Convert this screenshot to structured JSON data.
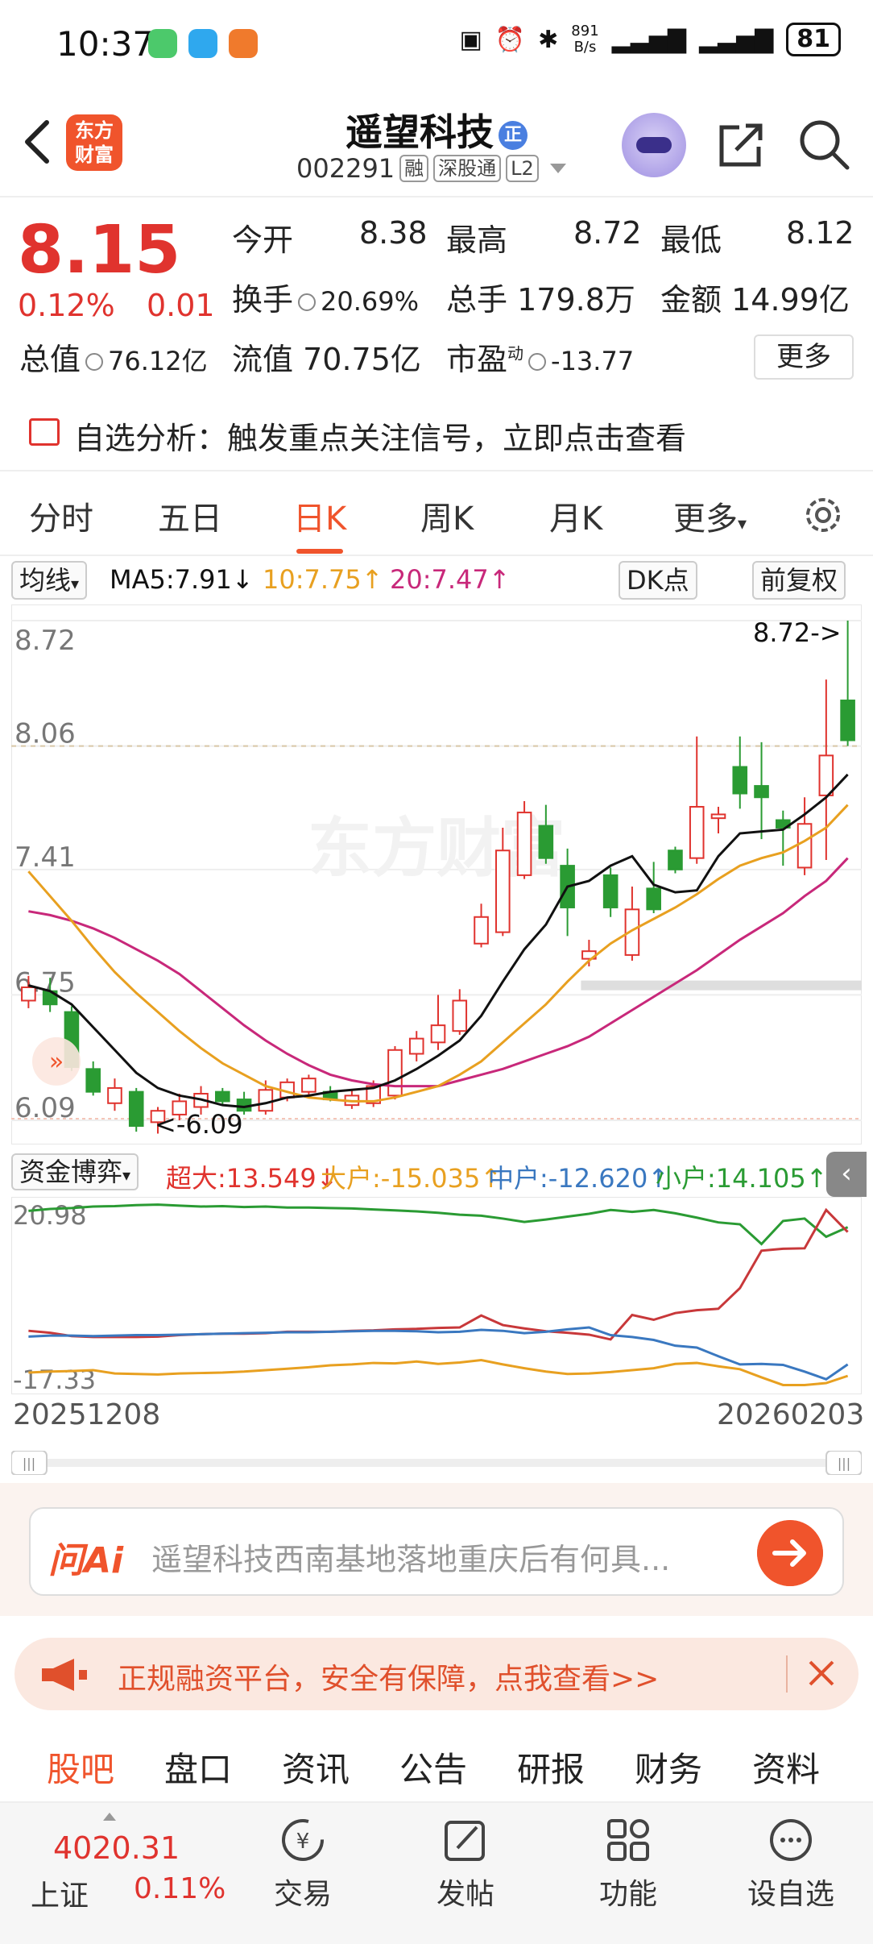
{
  "status_bar": {
    "time": "10:37",
    "net_speed_value": "891",
    "net_speed_unit": "B/s",
    "battery": "81"
  },
  "header": {
    "logo_text_1": "东方",
    "logo_text_2": "财富",
    "stock_name": "遥望科技",
    "badge": "正",
    "code": "002291",
    "tags": [
      "融",
      "深股通",
      "L2"
    ]
  },
  "quote": {
    "price": "8.15",
    "pct": "0.12%",
    "change": "0.01",
    "open_label": "今开",
    "open": "8.38",
    "high_label": "最高",
    "high": "8.72",
    "low_label": "最低",
    "low": "8.12",
    "turnover_label": "换手",
    "turnover": "20.69%",
    "volume_label": "总手",
    "volume": "179.8万",
    "amount_label": "金额",
    "amount": "14.99亿",
    "mktcap_label": "总值",
    "mktcap": "76.12亿",
    "float_label": "流值",
    "float": "70.75亿",
    "pe_label": "市盈",
    "pe_sup": "动",
    "pe": "-13.77",
    "more": "更多"
  },
  "notice": {
    "text": "自选分析：触发重点关注信号，立即点击查看"
  },
  "chart_tabs": [
    "分时",
    "五日",
    "日K",
    "周K",
    "月K",
    "更多"
  ],
  "active_chart_tab": "日K",
  "ma_row": {
    "selector": "均线",
    "ma5": "MA5:7.91↓",
    "ma10": "10:7.75↑",
    "ma20": "20:7.47↑",
    "dk": "DK点",
    "adjust": "前复权"
  },
  "colors": {
    "red": "#e0332e",
    "green": "#2a9b33",
    "ma5": "#111111",
    "ma10": "#e8a020",
    "ma20": "#c8287a",
    "accent": "#f0542c"
  },
  "chart_data": {
    "type": "candlestick",
    "y_labels": [
      "8.72",
      "8.06",
      "7.41",
      "6.75",
      "6.09"
    ],
    "ylim": [
      6.09,
      8.72
    ],
    "max_annotation": "8.72->",
    "min_annotation": "<-6.09",
    "watermark": "东方财富",
    "candles": [
      {
        "o": 6.72,
        "c": 6.79,
        "h": 6.85,
        "l": 6.68
      },
      {
        "o": 6.77,
        "c": 6.7,
        "h": 6.84,
        "l": 6.66
      },
      {
        "o": 6.66,
        "c": 6.37,
        "h": 6.69,
        "l": 6.35
      },
      {
        "o": 6.36,
        "c": 6.24,
        "h": 6.4,
        "l": 6.22
      },
      {
        "o": 6.18,
        "c": 6.26,
        "h": 6.31,
        "l": 6.14
      },
      {
        "o": 6.24,
        "c": 6.06,
        "h": 6.26,
        "l": 6.03
      },
      {
        "o": 6.08,
        "c": 6.14,
        "h": 6.16,
        "l": 6.02
      },
      {
        "o": 6.12,
        "c": 6.19,
        "h": 6.23,
        "l": 6.09
      },
      {
        "o": 6.16,
        "c": 6.23,
        "h": 6.27,
        "l": 6.12
      },
      {
        "o": 6.24,
        "c": 6.19,
        "h": 6.26,
        "l": 6.17
      },
      {
        "o": 6.2,
        "c": 6.14,
        "h": 6.24,
        "l": 6.12
      },
      {
        "o": 6.14,
        "c": 6.25,
        "h": 6.3,
        "l": 6.12
      },
      {
        "o": 6.21,
        "c": 6.29,
        "h": 6.31,
        "l": 6.19
      },
      {
        "o": 6.24,
        "c": 6.31,
        "h": 6.33,
        "l": 6.21
      },
      {
        "o": 6.24,
        "c": 6.2,
        "h": 6.27,
        "l": 6.19
      },
      {
        "o": 6.17,
        "c": 6.22,
        "h": 6.25,
        "l": 6.15
      },
      {
        "o": 6.18,
        "c": 6.27,
        "h": 6.3,
        "l": 6.16
      },
      {
        "o": 6.22,
        "c": 6.46,
        "h": 6.48,
        "l": 6.2
      },
      {
        "o": 6.44,
        "c": 6.52,
        "h": 6.56,
        "l": 6.4
      },
      {
        "o": 6.5,
        "c": 6.59,
        "h": 6.75,
        "l": 6.46
      },
      {
        "o": 6.56,
        "c": 6.72,
        "h": 6.78,
        "l": 6.54
      },
      {
        "o": 7.02,
        "c": 7.16,
        "h": 7.23,
        "l": 7.0
      },
      {
        "o": 7.08,
        "c": 7.51,
        "h": 7.63,
        "l": 7.06
      },
      {
        "o": 7.38,
        "c": 7.71,
        "h": 7.77,
        "l": 7.36
      },
      {
        "o": 7.64,
        "c": 7.47,
        "h": 7.75,
        "l": 7.44
      },
      {
        "o": 7.43,
        "c": 7.21,
        "h": 7.52,
        "l": 7.06
      },
      {
        "o": 6.94,
        "c": 6.98,
        "h": 7.04,
        "l": 6.9
      },
      {
        "o": 7.38,
        "c": 7.21,
        "h": 7.42,
        "l": 7.16
      },
      {
        "o": 6.96,
        "c": 7.2,
        "h": 7.32,
        "l": 6.93
      },
      {
        "o": 7.31,
        "c": 7.2,
        "h": 7.45,
        "l": 7.18
      },
      {
        "o": 7.51,
        "c": 7.41,
        "h": 7.53,
        "l": 7.39
      },
      {
        "o": 7.47,
        "c": 7.74,
        "h": 8.11,
        "l": 7.44
      },
      {
        "o": 7.68,
        "c": 7.7,
        "h": 7.74,
        "l": 7.6
      },
      {
        "o": 7.95,
        "c": 7.81,
        "h": 8.11,
        "l": 7.73
      },
      {
        "o": 7.85,
        "c": 7.79,
        "h": 8.08,
        "l": 7.57
      },
      {
        "o": 7.67,
        "c": 7.63,
        "h": 7.72,
        "l": 7.43
      },
      {
        "o": 7.42,
        "c": 7.65,
        "h": 7.79,
        "l": 7.38
      },
      {
        "o": 7.8,
        "c": 8.01,
        "h": 8.41,
        "l": 7.46
      },
      {
        "o": 8.3,
        "c": 8.09,
        "h": 8.72,
        "l": 8.06
      }
    ],
    "ma5": [
      6.8,
      6.77,
      6.7,
      6.58,
      6.46,
      6.34,
      6.26,
      6.22,
      6.2,
      6.17,
      6.16,
      6.18,
      6.21,
      6.22,
      6.24,
      6.25,
      6.26,
      6.3,
      6.36,
      6.43,
      6.51,
      6.64,
      6.82,
      6.99,
      7.12,
      7.32,
      7.35,
      7.43,
      7.48,
      7.33,
      7.29,
      7.3,
      7.48,
      7.6,
      7.61,
      7.62,
      7.7,
      7.79,
      7.91
    ],
    "ma10": [
      7.4,
      7.27,
      7.14,
      7.0,
      6.87,
      6.76,
      6.66,
      6.56,
      6.47,
      6.39,
      6.33,
      6.27,
      6.24,
      6.21,
      6.2,
      6.19,
      6.19,
      6.21,
      6.24,
      6.27,
      6.33,
      6.4,
      6.5,
      6.6,
      6.7,
      6.82,
      6.93,
      7.02,
      7.09,
      7.15,
      7.21,
      7.28,
      7.36,
      7.43,
      7.47,
      7.5,
      7.56,
      7.63,
      7.75
    ],
    "ma20": [
      7.19,
      7.17,
      7.14,
      7.1,
      7.05,
      6.99,
      6.93,
      6.86,
      6.77,
      6.68,
      6.59,
      6.51,
      6.44,
      6.38,
      6.33,
      6.3,
      6.28,
      6.27,
      6.27,
      6.27,
      6.3,
      6.33,
      6.36,
      6.4,
      6.44,
      6.48,
      6.53,
      6.6,
      6.67,
      6.74,
      6.81,
      6.88,
      6.96,
      7.04,
      7.11,
      7.18,
      7.27,
      7.35,
      7.47
    ]
  },
  "flow_row": {
    "selector": "资金博弈",
    "super": "超大:13.549↓",
    "large": "大户:-15.035↑",
    "mid": "中户:-12.620↑",
    "small": "小户:14.105↑"
  },
  "flow_chart": {
    "y_labels": [
      "20.98",
      "-17.33"
    ],
    "ylim": [
      -17.33,
      20.98
    ],
    "small": [
      19.4,
      19.8,
      20.0,
      20.3,
      20.4,
      20.6,
      20.7,
      20.5,
      20.3,
      20.4,
      20.2,
      20.3,
      20.1,
      20.1,
      20.0,
      19.9,
      19.7,
      19.5,
      19.3,
      19.0,
      18.6,
      18.4,
      17.8,
      17.1,
      17.6,
      18.2,
      18.8,
      19.6,
      19.2,
      19.6,
      18.9,
      18.0,
      17.0,
      16.6,
      12.5,
      17.3,
      17.8,
      14.0,
      16.0
    ],
    "super": [
      -5.6,
      -6.0,
      -6.7,
      -6.9,
      -6.9,
      -6.9,
      -6.8,
      -6.5,
      -6.3,
      -6.2,
      -6.2,
      -6.1,
      -5.8,
      -5.8,
      -5.8,
      -5.6,
      -5.5,
      -5.3,
      -5.2,
      -5.0,
      -4.9,
      -2.4,
      -4.4,
      -5.1,
      -5.7,
      -6.0,
      -6.4,
      -7.4,
      -2.3,
      -3.3,
      -1.9,
      -1.3,
      -1.0,
      3.3,
      11.1,
      11.5,
      11.6,
      19.6,
      15.0
    ],
    "large": [
      -14.3,
      -14.1,
      -14.0,
      -13.8,
      -14.5,
      -14.6,
      -14.7,
      -14.5,
      -14.4,
      -14.3,
      -14.1,
      -13.8,
      -13.5,
      -13.2,
      -12.8,
      -12.6,
      -12.3,
      -12.4,
      -12.0,
      -12.5,
      -12.2,
      -11.7,
      -12.6,
      -13.4,
      -14.1,
      -14.6,
      -14.5,
      -14.2,
      -13.8,
      -13.4,
      -12.5,
      -12.3,
      -13.0,
      -13.6,
      -15.3,
      -16.9,
      -16.9,
      -16.5,
      -15.0
    ],
    "mid": [
      -6.8,
      -6.6,
      -6.6,
      -6.7,
      -6.6,
      -6.5,
      -6.5,
      -6.4,
      -6.3,
      -6.2,
      -6.1,
      -6.0,
      -5.9,
      -5.9,
      -5.8,
      -5.7,
      -5.6,
      -5.6,
      -5.7,
      -5.9,
      -5.8,
      -5.4,
      -5.6,
      -6.1,
      -5.8,
      -5.3,
      -4.9,
      -6.5,
      -6.9,
      -7.5,
      -8.7,
      -9.1,
      -10.9,
      -12.6,
      -12.5,
      -12.7,
      -14.1,
      -15.7,
      -12.6
    ]
  },
  "dates": {
    "start": "20251208",
    "end": "20260203"
  },
  "ai": {
    "label": "问Ai",
    "question": "遥望科技西南基地落地重庆后有何具..."
  },
  "promo": {
    "text": "正规融资平台，安全有保障，点我查看>>"
  },
  "bottom_tabs": [
    "股吧",
    "盘口",
    "资讯",
    "公告",
    "研报",
    "财务",
    "资料"
  ],
  "active_bottom_tab": "股吧",
  "dock": {
    "index_value": "4020.31",
    "index_name": "上证",
    "index_pct": "0.11%",
    "items": [
      {
        "label": "交易",
        "icon": "trade-icon"
      },
      {
        "label": "发帖",
        "icon": "post-icon"
      },
      {
        "label": "功能",
        "icon": "function-icon"
      },
      {
        "label": "设自选",
        "icon": "add-watchlist-icon"
      }
    ]
  }
}
